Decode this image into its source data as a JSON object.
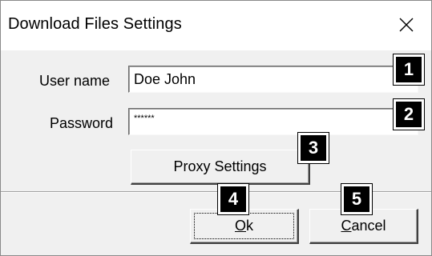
{
  "window": {
    "title": "Download Files Settings"
  },
  "form": {
    "username_label": "User name",
    "username_value": "Doe John",
    "password_label": "Password",
    "password_value": "******"
  },
  "buttons": {
    "proxy_label": "Proxy Settings",
    "ok_label": "Ok",
    "ok_mnemonic": "O",
    "ok_rest": "k",
    "cancel_label": "Cancel",
    "cancel_mnemonic": "C",
    "cancel_rest": "ancel"
  },
  "callouts": [
    "1",
    "2",
    "3",
    "4",
    "5"
  ],
  "icons": {
    "close": "close-icon"
  }
}
